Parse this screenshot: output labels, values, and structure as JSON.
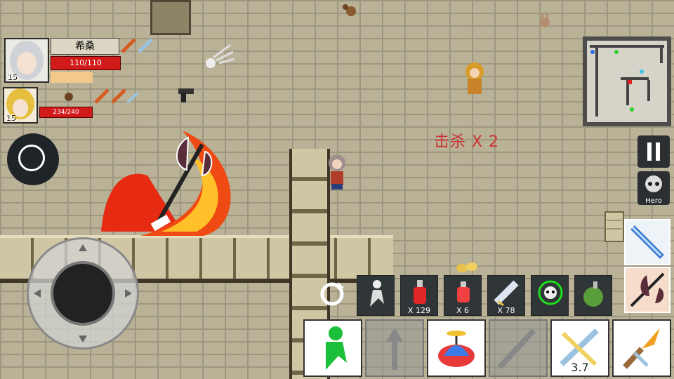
{
  "party": [
    {
      "name": "希桑",
      "level": "15",
      "hp_text": "110/110",
      "hp_fraction": 1.0,
      "mp_fraction": 0.6
    },
    {
      "level": "15",
      "hp_text": "234/240",
      "hp_fraction": 0.975
    }
  ],
  "combat": {
    "kill_text": "击杀 X 2"
  },
  "items": [
    {
      "icon": "refresh-icon",
      "count": ""
    },
    {
      "icon": "ghost-runner-icon",
      "count": ""
    },
    {
      "icon": "red-potion-icon",
      "count": "X 129"
    },
    {
      "icon": "red-potion-small-icon",
      "count": "X 6"
    },
    {
      "icon": "scroll-icon",
      "count": "X 78"
    },
    {
      "icon": "target-skull-icon",
      "count": ""
    },
    {
      "icon": "grenade-icon",
      "count": ""
    }
  ],
  "skills": [
    {
      "icon": "green-runner-icon",
      "active": true,
      "cooldown": ""
    },
    {
      "icon": "locked-arrow-icon",
      "active": false,
      "cooldown": ""
    },
    {
      "icon": "propeller-cap-icon",
      "active": true,
      "cooldown": ""
    },
    {
      "icon": "locked-sword-icon",
      "active": false,
      "cooldown": ""
    },
    {
      "icon": "crossed-blades-icon",
      "active": true,
      "cooldown": "3.7"
    },
    {
      "icon": "flame-sword-icon",
      "active": true,
      "cooldown": ""
    }
  ],
  "hero_button": {
    "label": "Hero"
  },
  "colors": {
    "hp": "#d11a1a",
    "mp": "#f2c98a",
    "kill_text": "#cc3030",
    "floor": "#b9b297"
  }
}
